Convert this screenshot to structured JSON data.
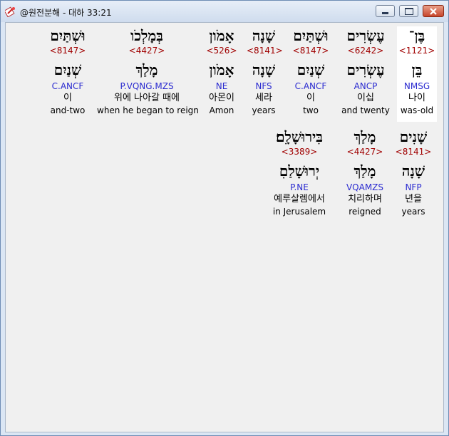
{
  "window": {
    "title": "@원전분해 - 대하 33:21",
    "icon": "bible-app-icon",
    "controls": {
      "minimize": "minimize-icon",
      "maximize": "maximize-icon",
      "close": "close-icon"
    }
  },
  "words": [
    {
      "hebrew": "בֶּן־",
      "strong": "<1121>",
      "lemma": "בֵּן",
      "parse": "NMSG",
      "korean": "나이",
      "english": "was-old",
      "highlighted": true
    },
    {
      "hebrew": "עֶשְׂרִים",
      "strong": "<6242>",
      "lemma": "עֶשְׂרִים",
      "parse": "ANCP",
      "korean": "이십",
      "english": "and twenty",
      "highlighted": false
    },
    {
      "hebrew": "וּשְׁתַּיִם",
      "strong": "<8147>",
      "lemma": "שְׁנַיִם",
      "parse": "C.ANCF",
      "korean": "이",
      "english": "two",
      "highlighted": false
    },
    {
      "hebrew": "שָׁנָה",
      "strong": "<8141>",
      "lemma": "שָׁנָה",
      "parse": "NFS",
      "korean": "세라",
      "english": "years",
      "highlighted": false
    },
    {
      "hebrew": "אָמֹון",
      "strong": "<526>",
      "lemma": "אָמֹון",
      "parse": "NE",
      "korean": "아몬이",
      "english": "Amon",
      "highlighted": false
    },
    {
      "hebrew": "בְּמָלְכֹו",
      "strong": "<4427>",
      "lemma": "מָלַךְ",
      "parse": "P.VQNG.MZS",
      "korean": "위에 나아갈 때에",
      "english": "when he began to reign",
      "highlighted": false
    },
    {
      "hebrew": "וּשְׁתַּיִם",
      "strong": "<8147>",
      "lemma": "שְׁנַיִם",
      "parse": "C.ANCF",
      "korean": "이",
      "english": "and-two",
      "highlighted": false
    },
    {
      "hebrew": "שָׁנִים",
      "strong": "<8141>",
      "lemma": "שָׁנָה",
      "parse": "NFP",
      "korean": "년을",
      "english": "years",
      "highlighted": false
    },
    {
      "hebrew": "מָלַךְ",
      "strong": "<4427>",
      "lemma": "מָלַךְ",
      "parse": "VQAMZS",
      "korean": "치리하며",
      "english": "reigned",
      "highlighted": false
    },
    {
      "hebrew": "בִּירוּשָׁלִָם׃",
      "strong": "<3389>",
      "lemma": "יְרוּשָׁלַםִ",
      "parse": "P.NE",
      "korean": "예루살렘에서",
      "english": "in Jerusalem",
      "highlighted": false
    }
  ]
}
